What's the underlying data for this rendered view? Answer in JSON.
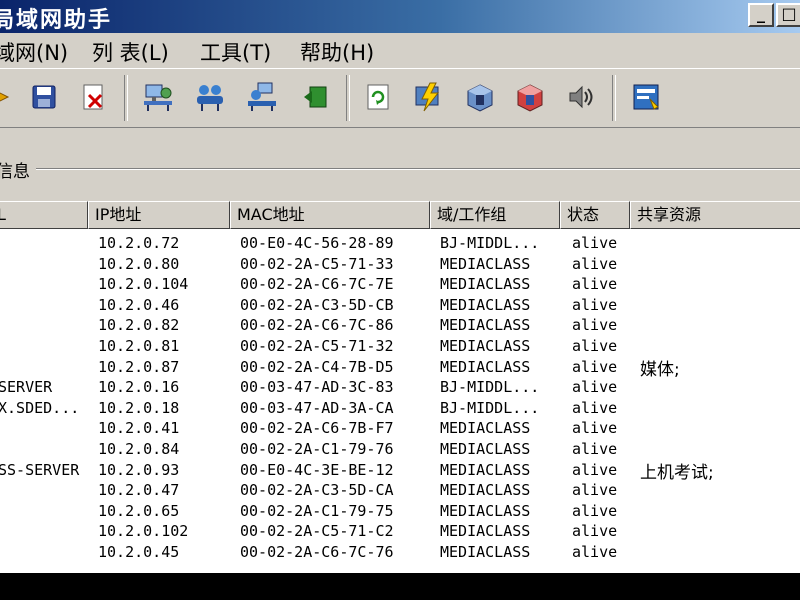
{
  "window": {
    "title": "局域网助手",
    "minimize": "_",
    "maximize": "□"
  },
  "menu": [
    {
      "label": "域网(N)"
    },
    {
      "label": "列 表(L)"
    },
    {
      "label": "工具(T)"
    },
    {
      "label": "帮助(H)"
    }
  ],
  "toolbar": {
    "icons": [
      "arrow-icon",
      "save-icon",
      "delete-icon",
      "network-computer-icon",
      "network-users-icon",
      "network-scan-icon",
      "export-icon",
      "refresh-icon",
      "flash-icon",
      "cube-icon",
      "cube-alt-icon",
      "speaker-icon",
      "properties-icon"
    ]
  },
  "group": {
    "label": "信息"
  },
  "table": {
    "columns": [
      "L",
      "IP地址",
      "MAC地址",
      "域/工作组",
      "状态",
      "共享资源"
    ],
    "rows": [
      {
        "name": "",
        "ip": "10.2.0.72",
        "mac": "00-E0-4C-56-28-89",
        "group": "BJ-MIDDL...",
        "status": "alive"
      },
      {
        "name": "",
        "ip": "10.2.0.80",
        "mac": "00-02-2A-C5-71-33",
        "group": "MEDIACLASS",
        "status": "alive"
      },
      {
        "name": "",
        "ip": "10.2.0.104",
        "mac": "00-02-2A-C6-7C-7E",
        "group": "MEDIACLASS",
        "status": "alive"
      },
      {
        "name": "",
        "ip": "10.2.0.46",
        "mac": "00-02-2A-C3-5D-CB",
        "group": "MEDIACLASS",
        "status": "alive"
      },
      {
        "name": "",
        "ip": "10.2.0.82",
        "mac": "00-02-2A-C6-7C-86",
        "group": "MEDIACLASS",
        "status": "alive"
      },
      {
        "name": "",
        "ip": "10.2.0.81",
        "mac": "00-02-2A-C5-71-32",
        "group": "MEDIACLASS",
        "status": "alive"
      },
      {
        "name": "",
        "ip": "10.2.0.87",
        "mac": "00-02-2A-C4-7B-D5",
        "group": "MEDIACLASS",
        "status": "alive"
      },
      {
        "name": "SERVER",
        "ip": "10.2.0.16",
        "mac": "00-03-47-AD-3C-83",
        "group": "BJ-MIDDL...",
        "status": "alive"
      },
      {
        "name": "X.SDED...",
        "ip": "10.2.0.18",
        "mac": "00-03-47-AD-3A-CA",
        "group": "BJ-MIDDL...",
        "status": "alive"
      },
      {
        "name": "",
        "ip": "10.2.0.41",
        "mac": "00-02-2A-C6-7B-F7",
        "group": "MEDIACLASS",
        "status": "alive"
      },
      {
        "name": "",
        "ip": "10.2.0.84",
        "mac": "00-02-2A-C1-79-76",
        "group": "MEDIACLASS",
        "status": "alive"
      },
      {
        "name": "SS-SERVER",
        "ip": "10.2.0.93",
        "mac": "00-E0-4C-3E-BE-12",
        "group": "MEDIACLASS",
        "status": "alive"
      },
      {
        "name": "",
        "ip": "10.2.0.47",
        "mac": "00-02-2A-C3-5D-CA",
        "group": "MEDIACLASS",
        "status": "alive"
      },
      {
        "name": "",
        "ip": "10.2.0.65",
        "mac": "00-02-2A-C1-79-75",
        "group": "MEDIACLASS",
        "status": "alive"
      },
      {
        "name": "",
        "ip": "10.2.0.102",
        "mac": "00-02-2A-C5-71-C2",
        "group": "MEDIACLASS",
        "status": "alive"
      },
      {
        "name": "",
        "ip": "10.2.0.45",
        "mac": "00-02-2A-C6-7C-76",
        "group": "MEDIACLASS",
        "status": "alive"
      }
    ],
    "shares": [
      {
        "label": "媒体;",
        "row": 6
      },
      {
        "label": "上机考试;",
        "row": 11
      }
    ]
  },
  "colors": {
    "face": "#d4d0c8",
    "title_start": "#0a246a",
    "title_end": "#a6caf0"
  }
}
